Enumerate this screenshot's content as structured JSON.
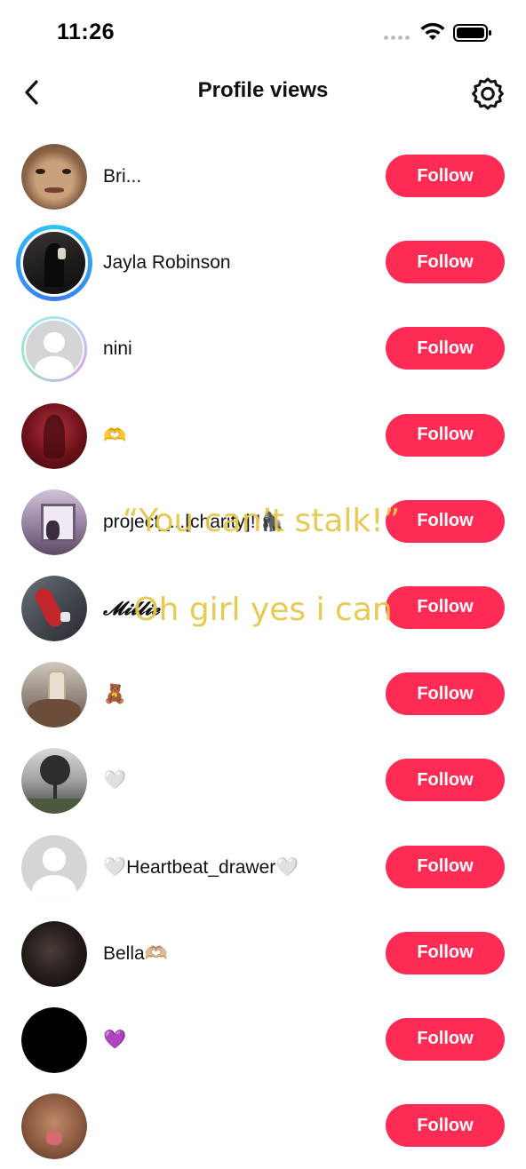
{
  "status_bar": {
    "time": "11:26"
  },
  "header": {
    "title": "Profile views"
  },
  "follow_label": "Follow",
  "viewers": [
    {
      "name": "Bri...",
      "avatar": "photo-face-closeup",
      "ring": ""
    },
    {
      "name": "Jayla Robinson",
      "avatar": "photo-mirror-selfie-dark",
      "ring": "blue"
    },
    {
      "name": "nini",
      "avatar": "default-avatar",
      "ring": "pastel"
    },
    {
      "name": "🫶",
      "avatar": "photo-red-tint",
      "ring": ""
    },
    {
      "name": "project_...[charity]!!🦍",
      "avatar": "photo-window-scene",
      "ring": ""
    },
    {
      "name": "𝓜𝓲𝓵𝓵𝓲𝓮",
      "avatar": "photo-red-bottle",
      "ring": ""
    },
    {
      "name": "🧸",
      "avatar": "photo-phone-selfie",
      "ring": ""
    },
    {
      "name": "🤍",
      "avatar": "photo-tree-silhouette",
      "ring": ""
    },
    {
      "name": "🤍Heartbeat_drawer🤍",
      "avatar": "default-avatar",
      "ring": ""
    },
    {
      "name": "Bella🫶🏼",
      "avatar": "photo-dark-face",
      "ring": ""
    },
    {
      "name": "💜",
      "avatar": "solid-black",
      "ring": ""
    },
    {
      "name": "",
      "avatar": "photo-face-tongue",
      "ring": ""
    }
  ],
  "overlay": {
    "line1": "“You can’t stalk!”",
    "line2": "Oh girl yes i can"
  },
  "colors": {
    "follow_button": "#fe2c55",
    "overlay_text": "#e6c84a",
    "story_ring": "#2ec5f5"
  }
}
